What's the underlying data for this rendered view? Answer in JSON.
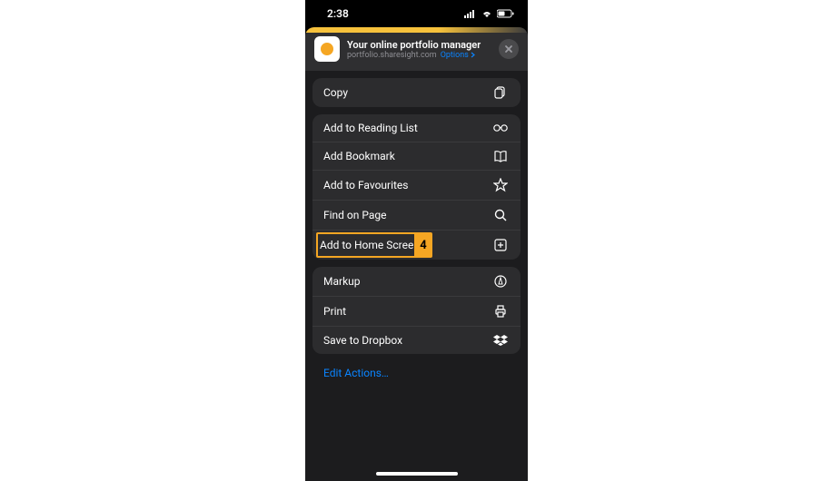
{
  "status": {
    "time": "2:38"
  },
  "header": {
    "title": "Your online portfolio manager",
    "domain": "portfolio.sharesight.com",
    "options": "Options"
  },
  "groups": {
    "copy": "Copy",
    "actions1": [
      "Add to Reading List",
      "Add Bookmark",
      "Add to Favourites",
      "Find on Page",
      "Add to Home Screen"
    ],
    "actions2": [
      "Markup",
      "Print",
      "Save to Dropbox"
    ]
  },
  "annotation": {
    "badge": "4"
  },
  "editLink": "Edit Actions…"
}
